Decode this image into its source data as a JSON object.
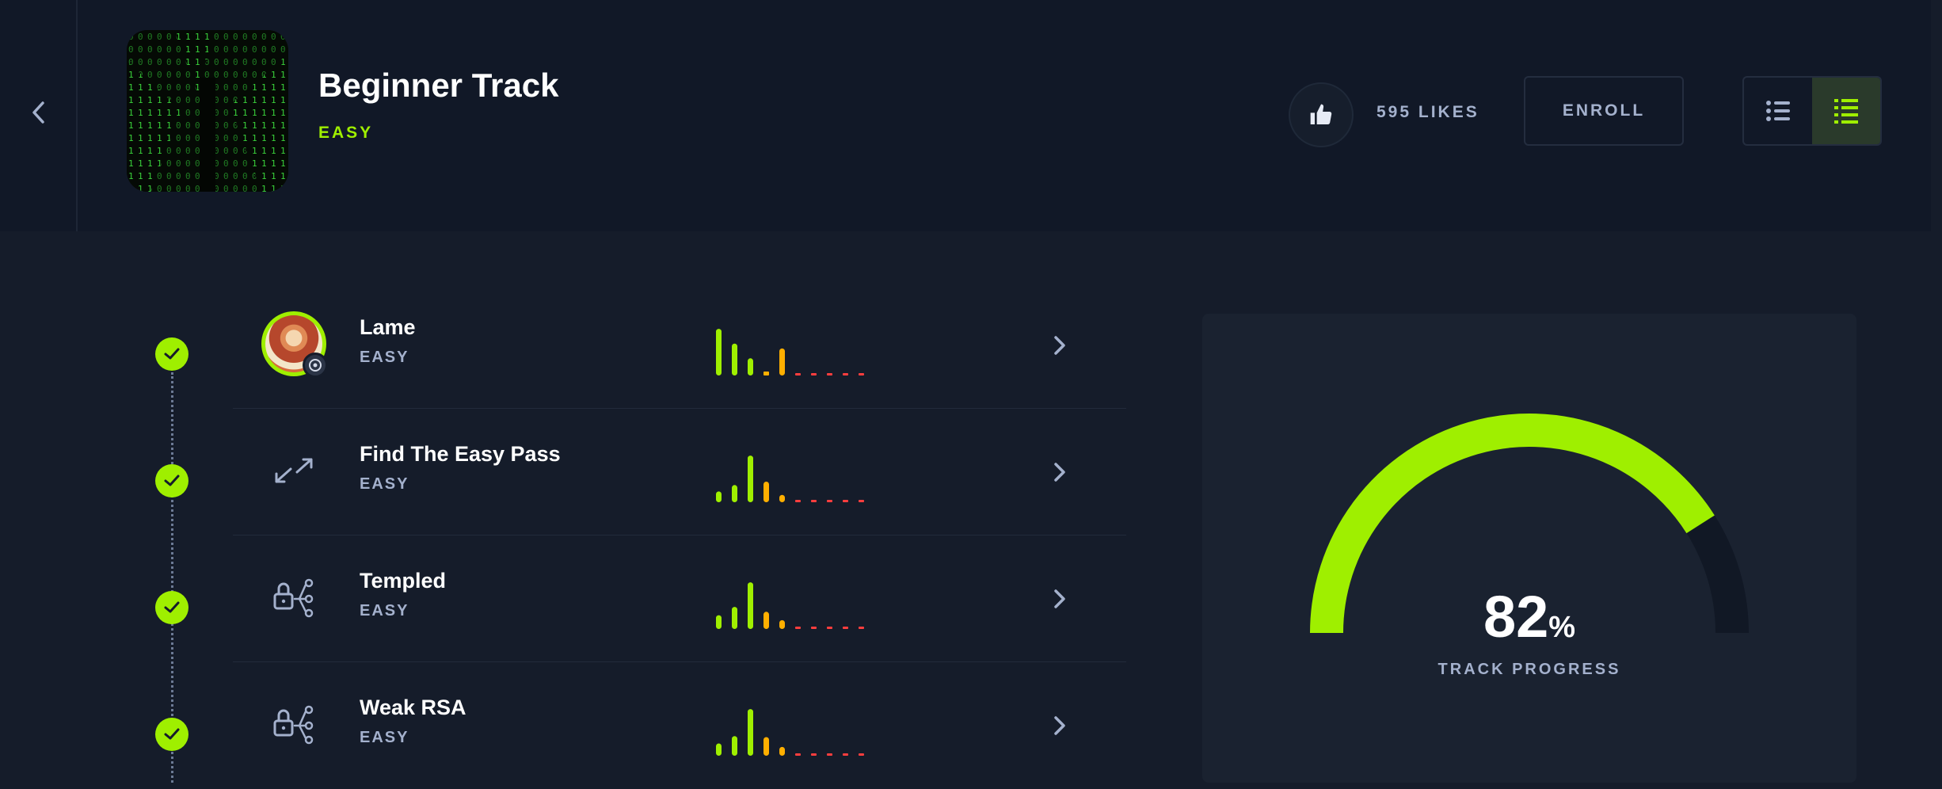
{
  "header": {
    "back_icon": "chevron-left-icon",
    "track_title": "Beginner Track",
    "track_difficulty": "EASY",
    "likes_label": "595 LIKES",
    "enroll_label": "ENROLL",
    "like_icon": "thumbs-up-icon",
    "view_options": [
      "list-view-icon",
      "detailed-list-view-icon"
    ],
    "active_view": 1
  },
  "colors": {
    "accent": "#9fef00",
    "bar_green": "#9fef00",
    "bar_orange": "#ffaf00",
    "bar_red": "#ff3e3e",
    "muted_text": "#a4b1cd"
  },
  "items": [
    {
      "name": "Lame",
      "difficulty": "EASY",
      "icon": "machine-avatar-icon",
      "completed": true,
      "ratings": [
        0.95,
        0.65,
        0.35,
        0.08,
        0.55,
        0.02,
        0.02,
        0.02,
        0.02,
        0.02
      ]
    },
    {
      "name": "Find The Easy Pass",
      "difficulty": "EASY",
      "icon": "reversing-icon",
      "completed": true,
      "ratings": [
        0.22,
        0.35,
        0.95,
        0.42,
        0.15,
        0.03,
        0.02,
        0.02,
        0.02,
        0.02
      ]
    },
    {
      "name": "Templed",
      "difficulty": "EASY",
      "icon": "crypto-lock-icon",
      "completed": true,
      "ratings": [
        0.28,
        0.45,
        0.95,
        0.35,
        0.18,
        0.03,
        0.02,
        0.02,
        0.02,
        0.02
      ]
    },
    {
      "name": "Weak RSA",
      "difficulty": "EASY",
      "icon": "crypto-lock-icon",
      "completed": true,
      "ratings": [
        0.25,
        0.4,
        0.95,
        0.38,
        0.18,
        0.03,
        0.02,
        0.02,
        0.02,
        0.02
      ]
    }
  ],
  "progress": {
    "value": "82",
    "percent_sign": "%",
    "label": "TRACK PROGRESS",
    "fraction": 0.82
  }
}
